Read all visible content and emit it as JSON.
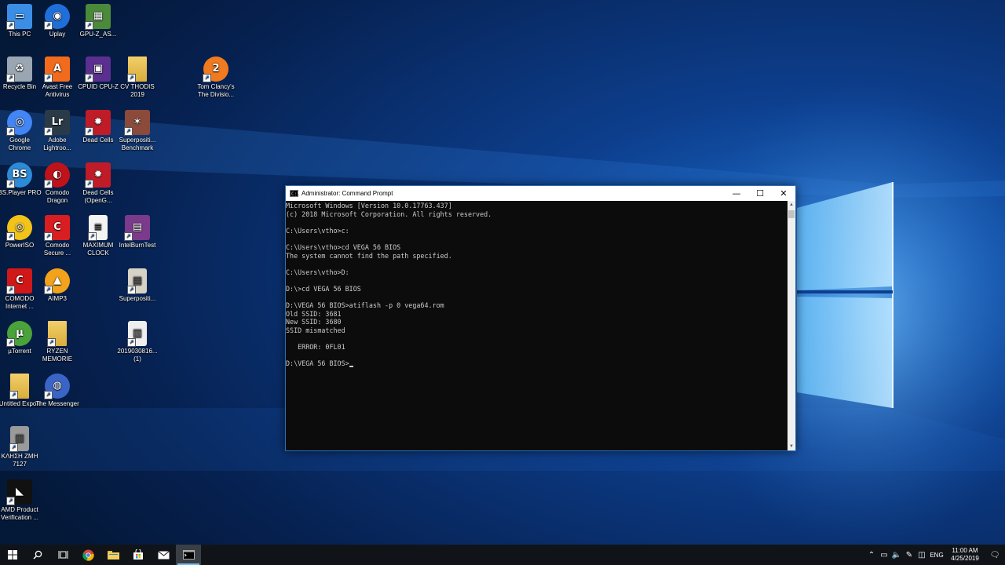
{
  "desktop": {
    "icons": [
      {
        "label": "This PC",
        "icon": "computer-icon",
        "color": "#3a8ee6"
      },
      {
        "label": "Uplay",
        "icon": "uplay-icon",
        "color": "#1e6fd9"
      },
      {
        "label": "GPU-Z_AS...",
        "icon": "gpu-icon",
        "color": "#4a8a3a"
      },
      {
        "label": "Recycle Bin",
        "icon": "recycle-bin-icon",
        "color": "#9aa6b2"
      },
      {
        "label": "Avast Free Antivirus",
        "icon": "avast-icon",
        "color": "#f26b1d"
      },
      {
        "label": "CPUID CPU-Z",
        "icon": "cpuz-icon",
        "color": "#5a2f8f"
      },
      {
        "label": "CV THODIS 2019",
        "icon": "folder-icon",
        "color": "#e8c35a"
      },
      {
        "label": "Tom Clancy's The Divisio...",
        "icon": "division-icon",
        "color": "#f07a20"
      },
      {
        "label": "Google Chrome",
        "icon": "chrome-icon",
        "color": "#4285f4"
      },
      {
        "label": "Adobe Lightroo...",
        "icon": "lightroom-icon",
        "color": "#2b3a47"
      },
      {
        "label": "Dead Cells",
        "icon": "dead-cells-icon",
        "color": "#c01c28"
      },
      {
        "label": "Superpositi... Benchmark",
        "icon": "superposition-icon",
        "color": "#8b4a3a"
      },
      {
        "label": "BS.Player PRO",
        "icon": "bsplayer-icon",
        "color": "#2d8ad6"
      },
      {
        "label": "Comodo Dragon",
        "icon": "comodo-dragon-icon",
        "color": "#c0121a"
      },
      {
        "label": "Dead Cells (OpenG...",
        "icon": "dead-cells-icon",
        "color": "#c01c28"
      },
      {
        "label": "PowerISO",
        "icon": "poweriso-icon",
        "color": "#f2c318"
      },
      {
        "label": "Comodo Secure ...",
        "icon": "comodo-secure-icon",
        "color": "#d81e20"
      },
      {
        "label": "MAXIMUM CLOCK",
        "icon": "document-icon",
        "color": "#f4f4f4"
      },
      {
        "label": "IntelBurnTest",
        "icon": "winrar-icon",
        "color": "#7c3a8c"
      },
      {
        "label": "COMODO Internet ...",
        "icon": "comodo-internet-icon",
        "color": "#d01818"
      },
      {
        "label": "AIMP3",
        "icon": "aimp-icon",
        "color": "#f2a21b"
      },
      {
        "label": "Superpositi...",
        "icon": "superposition-file-icon",
        "color": "#d7d2c6"
      },
      {
        "label": "µTorrent",
        "icon": "utorrent-icon",
        "color": "#4aa23a"
      },
      {
        "label": "RYZEN MEMORIE",
        "icon": "folder-icon",
        "color": "#e8c35a"
      },
      {
        "label": "2019030816... (1)",
        "icon": "image-file-icon",
        "color": "#efefef"
      },
      {
        "label": "Untitled Export",
        "icon": "folder-icon",
        "color": "#e8c35a"
      },
      {
        "label": "The Messenger",
        "icon": "messenger-icon",
        "color": "#3a64c6"
      },
      {
        "label": "ΚΛΗΣΗ ΖΜΗ 7127",
        "icon": "image-file-icon",
        "color": "#9a9a9a"
      },
      {
        "label": "AMD Product Verification ...",
        "icon": "amd-icon",
        "color": "#111111"
      }
    ]
  },
  "cmd_window": {
    "title": "Administrator: Command Prompt",
    "minimize": "—",
    "maximize": "☐",
    "close": "✕",
    "lines": [
      "Microsoft Windows [Version 10.0.17763.437]",
      "(c) 2018 Microsoft Corporation. All rights reserved.",
      "",
      "C:\\Users\\vtho>c:",
      "",
      "C:\\Users\\vtho>cd VEGA 56 BIOS",
      "The system cannot find the path specified.",
      "",
      "C:\\Users\\vtho>D:",
      "",
      "D:\\>cd VEGA 56 BIOS",
      "",
      "D:\\VEGA 56 BIOS>atiflash -p 0 vega64.rom",
      "Old SSID: 3681",
      "New SSID: 3680",
      "SSID mismatched",
      "",
      "   ERROR: 0FL01",
      "",
      "D:\\VEGA 56 BIOS>"
    ]
  },
  "taskbar": {
    "language": "ENG",
    "time": "11:00 AM",
    "date": "4/25/2019"
  }
}
